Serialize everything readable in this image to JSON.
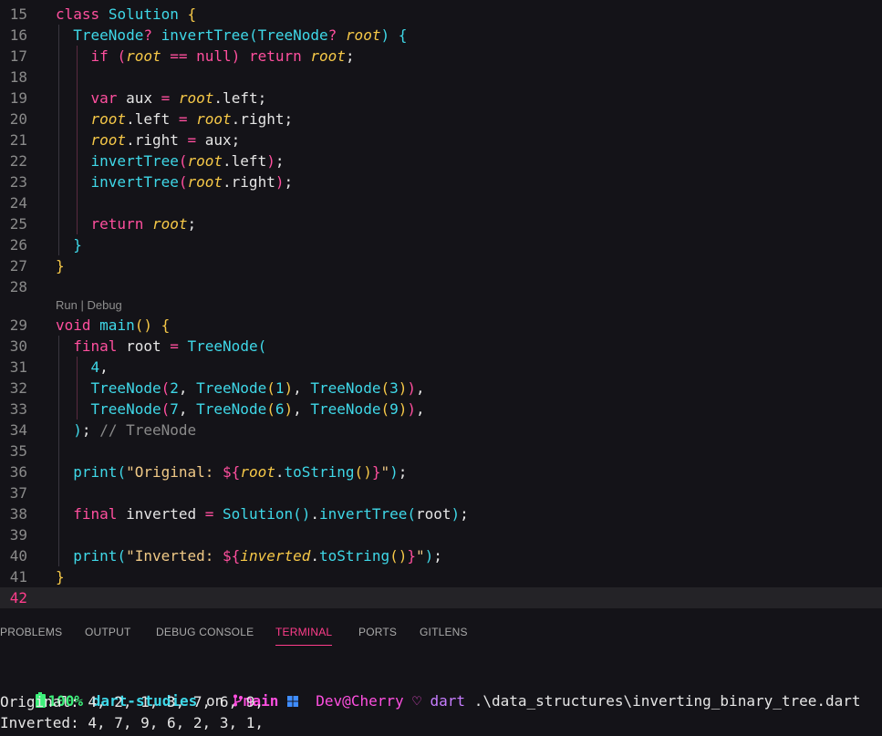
{
  "editor": {
    "codelens": {
      "run": "Run",
      "sep": " | ",
      "debug": "Debug"
    },
    "lines": [
      {
        "n": "15",
        "tokens": [
          [
            "class",
            "kw"
          ],
          [
            " ",
            ""
          ],
          [
            "Solution",
            "cls"
          ],
          [
            " ",
            ""
          ],
          [
            "{",
            "br1"
          ]
        ]
      },
      {
        "n": "16",
        "tokens": [
          [
            "  ",
            ""
          ],
          [
            "TreeNode",
            "cls"
          ],
          [
            "?",
            "op"
          ],
          [
            " ",
            ""
          ],
          [
            "invertTree",
            "fn"
          ],
          [
            "(",
            "br2"
          ],
          [
            "TreeNode",
            "cls"
          ],
          [
            "?",
            "op"
          ],
          [
            " ",
            ""
          ],
          [
            "root",
            "par"
          ],
          [
            ")",
            "br2"
          ],
          [
            " ",
            ""
          ],
          [
            "{",
            "br2"
          ]
        ]
      },
      {
        "n": "17",
        "tokens": [
          [
            "    ",
            ""
          ],
          [
            "if",
            "kw"
          ],
          [
            " ",
            ""
          ],
          [
            "(",
            "br3"
          ],
          [
            "root",
            "par"
          ],
          [
            " ",
            ""
          ],
          [
            "==",
            "op"
          ],
          [
            " ",
            ""
          ],
          [
            "null",
            "lit"
          ],
          [
            ")",
            "br3"
          ],
          [
            " ",
            ""
          ],
          [
            "return",
            "kw"
          ],
          [
            " ",
            ""
          ],
          [
            "root",
            "par"
          ],
          [
            ";",
            "punc"
          ]
        ]
      },
      {
        "n": "18",
        "tokens": []
      },
      {
        "n": "19",
        "tokens": [
          [
            "    ",
            ""
          ],
          [
            "var",
            "kw"
          ],
          [
            " aux ",
            "var"
          ],
          [
            "=",
            "op"
          ],
          [
            " ",
            ""
          ],
          [
            "root",
            "par"
          ],
          [
            ".left;",
            "var"
          ]
        ]
      },
      {
        "n": "20",
        "tokens": [
          [
            "    ",
            ""
          ],
          [
            "root",
            "par"
          ],
          [
            ".left ",
            "var"
          ],
          [
            "=",
            "op"
          ],
          [
            " ",
            ""
          ],
          [
            "root",
            "par"
          ],
          [
            ".right;",
            "var"
          ]
        ]
      },
      {
        "n": "21",
        "tokens": [
          [
            "    ",
            ""
          ],
          [
            "root",
            "par"
          ],
          [
            ".right ",
            "var"
          ],
          [
            "=",
            "op"
          ],
          [
            " aux;",
            "var"
          ]
        ]
      },
      {
        "n": "22",
        "tokens": [
          [
            "    ",
            ""
          ],
          [
            "invertTree",
            "fn"
          ],
          [
            "(",
            "br3"
          ],
          [
            "root",
            "par"
          ],
          [
            ".left",
            "var"
          ],
          [
            ")",
            "br3"
          ],
          [
            ";",
            "punc"
          ]
        ]
      },
      {
        "n": "23",
        "tokens": [
          [
            "    ",
            ""
          ],
          [
            "invertTree",
            "fn"
          ],
          [
            "(",
            "br3"
          ],
          [
            "root",
            "par"
          ],
          [
            ".right",
            "var"
          ],
          [
            ")",
            "br3"
          ],
          [
            ";",
            "punc"
          ]
        ]
      },
      {
        "n": "24",
        "tokens": []
      },
      {
        "n": "25",
        "tokens": [
          [
            "    ",
            ""
          ],
          [
            "return",
            "kw"
          ],
          [
            " ",
            ""
          ],
          [
            "root",
            "par"
          ],
          [
            ";",
            "punc"
          ]
        ]
      },
      {
        "n": "26",
        "tokens": [
          [
            "  ",
            ""
          ],
          [
            "}",
            "br2"
          ]
        ]
      },
      {
        "n": "27",
        "tokens": [
          [
            "}",
            "br1"
          ]
        ]
      },
      {
        "n": "28",
        "tokens": []
      },
      {
        "n": "29",
        "tokens": [
          [
            "void",
            "kw"
          ],
          [
            " ",
            ""
          ],
          [
            "main",
            "fn"
          ],
          [
            "(",
            "br1"
          ],
          [
            ")",
            "br1"
          ],
          [
            " ",
            ""
          ],
          [
            "{",
            "br1"
          ]
        ]
      },
      {
        "n": "30",
        "tokens": [
          [
            "  ",
            ""
          ],
          [
            "final",
            "kw"
          ],
          [
            " root ",
            "var"
          ],
          [
            "=",
            "op"
          ],
          [
            " ",
            ""
          ],
          [
            "TreeNode",
            "cls"
          ],
          [
            "(",
            "br2"
          ]
        ]
      },
      {
        "n": "31",
        "tokens": [
          [
            "    ",
            ""
          ],
          [
            "4",
            "num"
          ],
          [
            ",",
            "punc"
          ]
        ]
      },
      {
        "n": "32",
        "tokens": [
          [
            "    ",
            ""
          ],
          [
            "TreeNode",
            "cls"
          ],
          [
            "(",
            "br3"
          ],
          [
            "2",
            "num"
          ],
          [
            ", ",
            "punc"
          ],
          [
            "TreeNode",
            "cls"
          ],
          [
            "(",
            "br1"
          ],
          [
            "1",
            "num"
          ],
          [
            ")",
            "br1"
          ],
          [
            ", ",
            "punc"
          ],
          [
            "TreeNode",
            "cls"
          ],
          [
            "(",
            "br1"
          ],
          [
            "3",
            "num"
          ],
          [
            ")",
            "br1"
          ],
          [
            ")",
            "br3"
          ],
          [
            ",",
            "punc"
          ]
        ]
      },
      {
        "n": "33",
        "tokens": [
          [
            "    ",
            ""
          ],
          [
            "TreeNode",
            "cls"
          ],
          [
            "(",
            "br3"
          ],
          [
            "7",
            "num"
          ],
          [
            ", ",
            "punc"
          ],
          [
            "TreeNode",
            "cls"
          ],
          [
            "(",
            "br1"
          ],
          [
            "6",
            "num"
          ],
          [
            ")",
            "br1"
          ],
          [
            ", ",
            "punc"
          ],
          [
            "TreeNode",
            "cls"
          ],
          [
            "(",
            "br1"
          ],
          [
            "9",
            "num"
          ],
          [
            ")",
            "br1"
          ],
          [
            ")",
            "br3"
          ],
          [
            ",",
            "punc"
          ]
        ]
      },
      {
        "n": "34",
        "tokens": [
          [
            "  ",
            ""
          ],
          [
            ")",
            "br2"
          ],
          [
            ";",
            "punc"
          ],
          [
            " ",
            ""
          ],
          [
            "// TreeNode",
            "com"
          ]
        ]
      },
      {
        "n": "35",
        "tokens": []
      },
      {
        "n": "36",
        "tokens": [
          [
            "  ",
            ""
          ],
          [
            "print",
            "fn"
          ],
          [
            "(",
            "br2"
          ],
          [
            "\"Original: ",
            "str"
          ],
          [
            "${",
            "br3"
          ],
          [
            "root",
            "par"
          ],
          [
            ".",
            "var"
          ],
          [
            "toString",
            "fn"
          ],
          [
            "(",
            "br1"
          ],
          [
            ")",
            "br1"
          ],
          [
            "}",
            "br3"
          ],
          [
            "\"",
            "str"
          ],
          [
            ")",
            "br2"
          ],
          [
            ";",
            "punc"
          ]
        ]
      },
      {
        "n": "37",
        "tokens": []
      },
      {
        "n": "38",
        "tokens": [
          [
            "  ",
            ""
          ],
          [
            "final",
            "kw"
          ],
          [
            " inverted ",
            "var"
          ],
          [
            "=",
            "op"
          ],
          [
            " ",
            ""
          ],
          [
            "Solution",
            "cls"
          ],
          [
            "(",
            "br2"
          ],
          [
            ")",
            "br2"
          ],
          [
            ".",
            "var"
          ],
          [
            "invertTree",
            "fn"
          ],
          [
            "(",
            "br2"
          ],
          [
            "root",
            "var"
          ],
          [
            ")",
            "br2"
          ],
          [
            ";",
            "punc"
          ]
        ]
      },
      {
        "n": "39",
        "tokens": []
      },
      {
        "n": "40",
        "tokens": [
          [
            "  ",
            ""
          ],
          [
            "print",
            "fn"
          ],
          [
            "(",
            "br2"
          ],
          [
            "\"Inverted: ",
            "str"
          ],
          [
            "${",
            "br3"
          ],
          [
            "inverted",
            "par"
          ],
          [
            ".",
            "var"
          ],
          [
            "toString",
            "fn"
          ],
          [
            "(",
            "br1"
          ],
          [
            ")",
            "br1"
          ],
          [
            "}",
            "br3"
          ],
          [
            "\"",
            "str"
          ],
          [
            ")",
            "br2"
          ],
          [
            ";",
            "punc"
          ]
        ]
      },
      {
        "n": "41",
        "tokens": [
          [
            "}",
            "br1"
          ]
        ]
      },
      {
        "n": "42",
        "tokens": []
      }
    ]
  },
  "panel": {
    "tabs": [
      "PROBLEMS",
      "OUTPUT",
      "DEBUG CONSOLE",
      "TERMINAL",
      "PORTS",
      "GITLENS"
    ],
    "active_tab": "TERMINAL"
  },
  "terminal": {
    "prompt": {
      "battery": "100%",
      "dir": "dart-studies",
      "on": "on",
      "branch": "main",
      "user": "Dev@Cherry",
      "heart": "♡",
      "command": "dart",
      "args": ".\\data_structures\\inverting_binary_tree.dart"
    },
    "output": [
      "Original: 4, 2, 1, 3, 7, 6, 9,",
      "Inverted: 4, 7, 9, 6, 2, 3, 1,"
    ]
  },
  "colors": {
    "background": "#141318",
    "accent": "#ff3d8b",
    "current_line": "#242327"
  }
}
